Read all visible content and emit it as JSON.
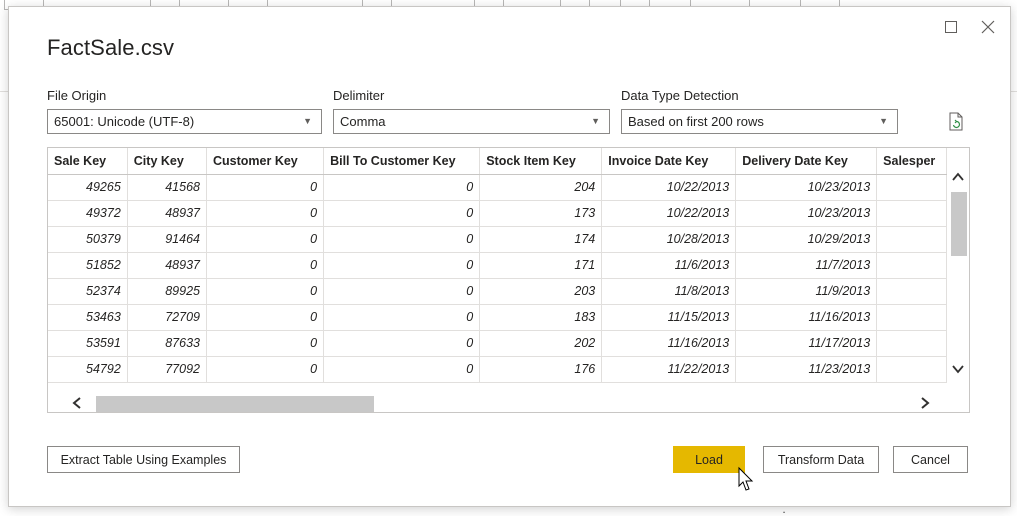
{
  "dialog": {
    "title": "FactSale.csv"
  },
  "file_origin": {
    "label": "File Origin",
    "value": "65001: Unicode (UTF-8)"
  },
  "delimiter": {
    "label": "Delimiter",
    "value": "Comma"
  },
  "data_type_detection": {
    "label": "Data Type Detection",
    "value": "Based on first 200 rows"
  },
  "table": {
    "columns": [
      "Sale Key",
      "City Key",
      "Customer Key",
      "Bill To Customer Key",
      "Stock Item Key",
      "Invoice Date Key",
      "Delivery Date Key",
      "Salesper"
    ],
    "rows": [
      [
        "49265",
        "41568",
        "0",
        "0",
        "204",
        "10/22/2013",
        "10/23/2013",
        ""
      ],
      [
        "49372",
        "48937",
        "0",
        "0",
        "173",
        "10/22/2013",
        "10/23/2013",
        ""
      ],
      [
        "50379",
        "91464",
        "0",
        "0",
        "174",
        "10/28/2013",
        "10/29/2013",
        ""
      ],
      [
        "51852",
        "48937",
        "0",
        "0",
        "171",
        "11/6/2013",
        "11/7/2013",
        ""
      ],
      [
        "52374",
        "89925",
        "0",
        "0",
        "203",
        "11/8/2013",
        "11/9/2013",
        ""
      ],
      [
        "53463",
        "72709",
        "0",
        "0",
        "183",
        "11/15/2013",
        "11/16/2013",
        ""
      ],
      [
        "53591",
        "87633",
        "0",
        "0",
        "202",
        "11/16/2013",
        "11/17/2013",
        ""
      ],
      [
        "54792",
        "77092",
        "0",
        "0",
        "176",
        "11/22/2013",
        "11/23/2013",
        ""
      ]
    ]
  },
  "buttons": {
    "extract": "Extract Table Using Examples",
    "load": "Load",
    "transform": "Transform Data",
    "cancel": "Cancel"
  },
  "icons": {
    "maximize": "maximize-icon",
    "close": "close-icon",
    "refresh": "refresh-preview-icon",
    "caret": "chevron-down-icon"
  },
  "colors": {
    "accent": "#e5b800",
    "border": "#8a8886"
  }
}
